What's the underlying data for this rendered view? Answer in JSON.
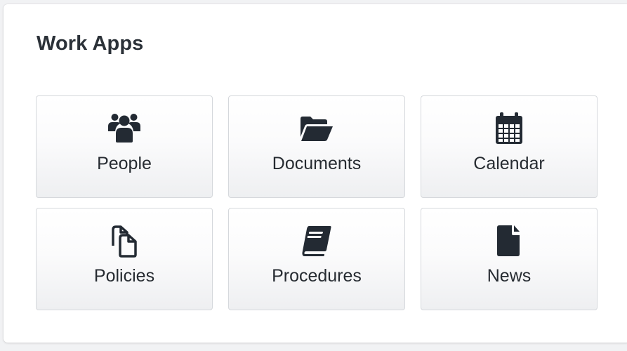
{
  "card": {
    "title": "Work Apps"
  },
  "apps": [
    {
      "label": "People",
      "icon": "users-icon"
    },
    {
      "label": "Documents",
      "icon": "folder-open-icon"
    },
    {
      "label": "Calendar",
      "icon": "calendar-icon"
    },
    {
      "label": "Policies",
      "icon": "copy-files-icon"
    },
    {
      "label": "Procedures",
      "icon": "book-icon"
    },
    {
      "label": "News",
      "icon": "file-icon"
    }
  ],
  "colors": {
    "icon": "#232a33",
    "text": "#262b31",
    "tile_border": "#d5d8dc"
  }
}
